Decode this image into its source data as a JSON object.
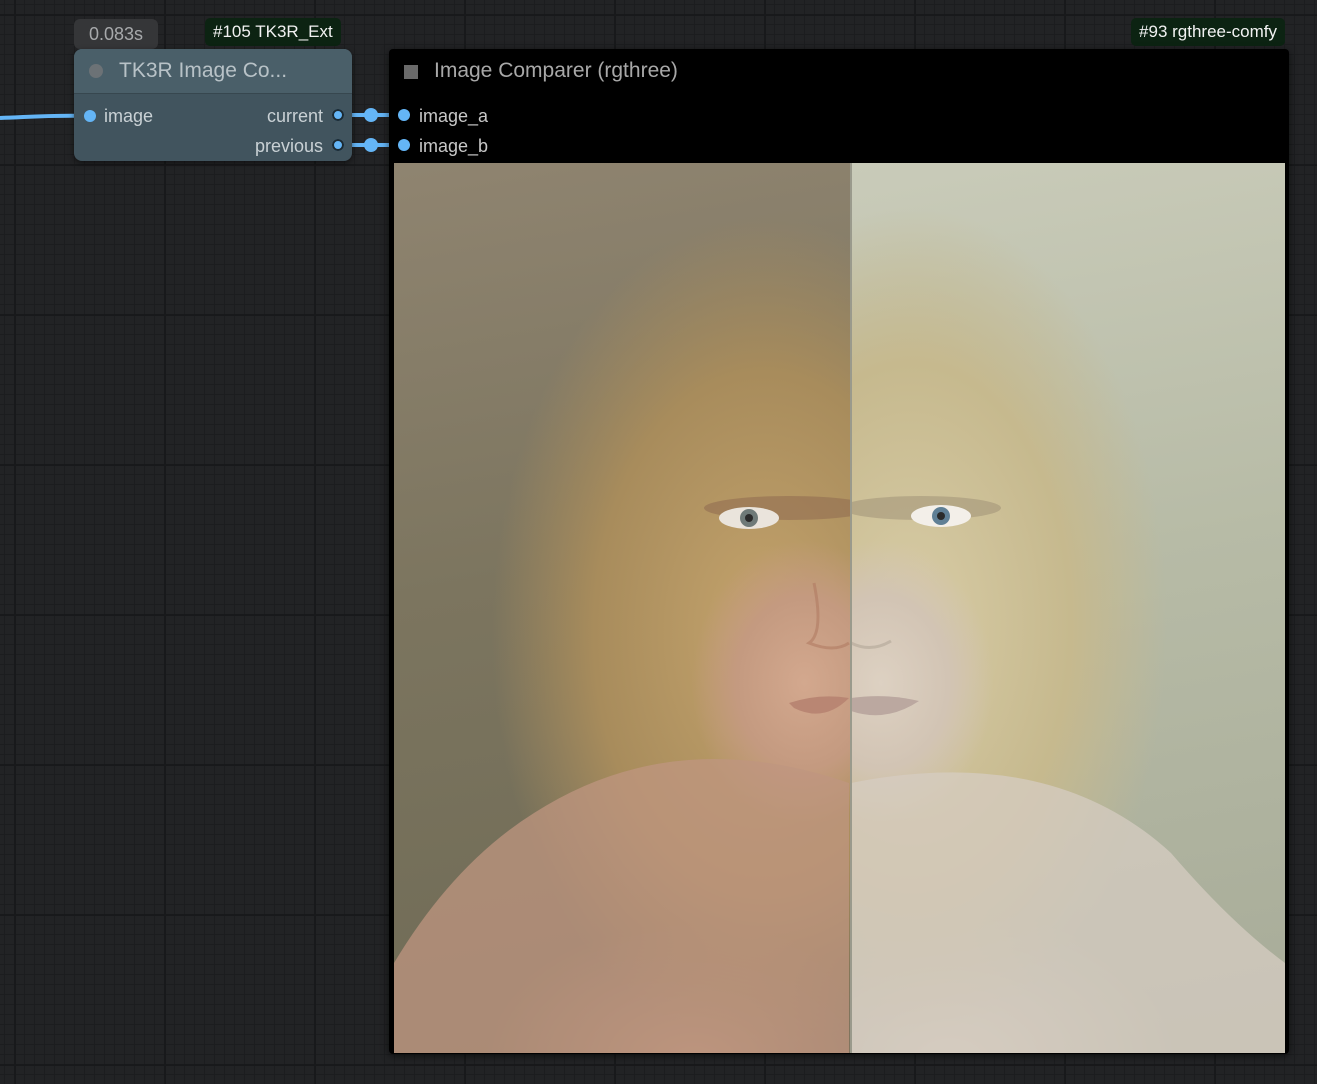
{
  "timing": {
    "duration": "0.083s"
  },
  "tags": {
    "tk3r": "#105 TK3R_Ext",
    "rgthree": "#93 rgthree-comfy"
  },
  "tk3r_node": {
    "title": "TK3R Image Co...",
    "inputs": [
      "image"
    ],
    "outputs": [
      "current",
      "previous"
    ]
  },
  "comparer_node": {
    "title": "Image Comparer (rgthree)",
    "inputs": [
      "image_a",
      "image_b"
    ],
    "images": {
      "a": "portrait-woman-warm-tone",
      "b": "portrait-woman-cool-tone"
    }
  },
  "colors": {
    "link": "#64b5f6",
    "tag_background": "#0c2312",
    "tk3r_node_body": "#41545e",
    "comparer_node_body": "#000000"
  }
}
